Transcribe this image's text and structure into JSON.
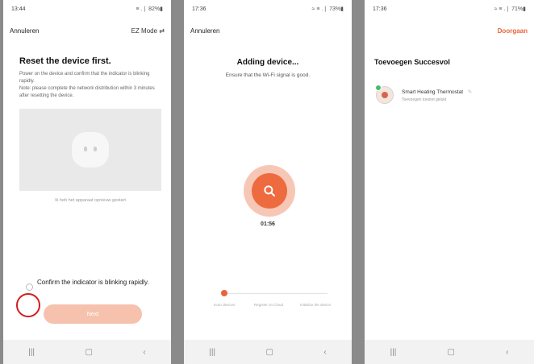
{
  "screen1": {
    "time": "13:44",
    "status_icons": "≡ .❘ 82%▮",
    "cancel": "Annuleren",
    "ez_mode": "EZ Mode",
    "ez_chevron": "⇄",
    "title": "Reset the device first.",
    "description": "Power on the device and confirm that the indicator is blinking rapidly.\nNote: please complete the network distribution within 3 minutes after resetting the device.",
    "help_link": "Ik heb het apparaat opnieuw gestart",
    "confirm_text": "Confirm the indicator is blinking rapidly.",
    "next_button": "Next"
  },
  "screen2": {
    "time": "17:36",
    "status_icons": "≈ ≡ .❘ 73%▮",
    "cancel": "Annuleren",
    "title": "Adding device...",
    "subtitle": "Ensure that the Wi-Fi signal is good.",
    "timer": "01:56",
    "steps": [
      {
        "label": "Scan devices"
      },
      {
        "label": "Register on Cloud"
      },
      {
        "label": "Initialize the device"
      }
    ]
  },
  "screen3": {
    "time": "17:36",
    "status_icons": "≈ ≡ .❘ 71%▮",
    "done": "Doorgaan",
    "title": "Toevoegen Succesvol",
    "device_name": "Smart Heating Thermostat",
    "device_edit": "✎",
    "device_status": "Toevoegen toestel gelukt"
  },
  "nav": {
    "recent": "|||",
    "home": "▢",
    "back": "‹"
  },
  "colors": {
    "accent": "#e8643a",
    "highlight_ring": "#d41c1c"
  }
}
